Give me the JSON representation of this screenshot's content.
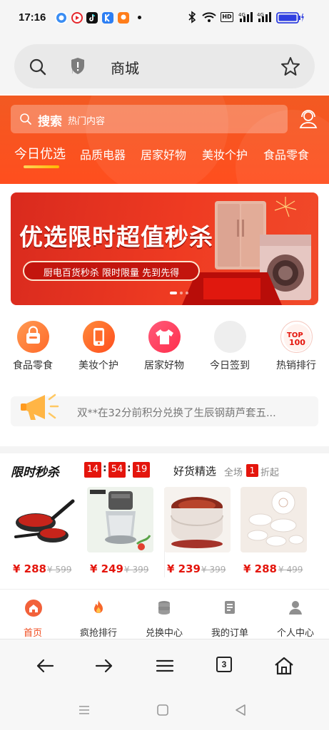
{
  "status_bar": {
    "time": "17:16",
    "battery_label": "HD",
    "signal_a": "4G",
    "signal_b": "4G"
  },
  "browser": {
    "address_title": "商城",
    "tab_count": "3"
  },
  "header": {
    "search_label": "搜索",
    "search_placeholder": "热门内容",
    "tabs": [
      {
        "label": "今日优选"
      },
      {
        "label": "品质电器"
      },
      {
        "label": "居家好物"
      },
      {
        "label": "美妆个护"
      },
      {
        "label": "食品零食"
      }
    ]
  },
  "banner": {
    "title": "优选限时超值秒杀",
    "subtitle": "厨电百货秒杀 限时限量 先到先得"
  },
  "categories": [
    {
      "label": "食品零食",
      "icon": "bag-icon",
      "color": "#ff7a3c"
    },
    {
      "label": "美妆个护",
      "icon": "phone-icon",
      "color": "#ff5a2e"
    },
    {
      "label": "居家好物",
      "icon": "shirt-icon",
      "color": "#ff3f5e"
    },
    {
      "label": "今日签到",
      "icon": "placeholder-icon",
      "color": "#eeeeee"
    },
    {
      "label": "热销排行",
      "icon": "top100-icon",
      "color": "#ffffff"
    }
  ],
  "notice": {
    "text": "双**在32分前积分兑换了生辰钢葫芦套五..."
  },
  "flash_sale": {
    "title": "限时秒杀",
    "hours": "14",
    "minutes": "54",
    "seconds": "19"
  },
  "good_picks": {
    "title": "好货精选",
    "sub_prefix": "全场",
    "badge": "1",
    "sub_suffix": "折起"
  },
  "products": [
    {
      "name": "炒锅套装",
      "price": "¥ 288",
      "original": "¥ 599"
    },
    {
      "name": "绞肉机",
      "price": "¥ 249",
      "original": "¥ 399"
    },
    {
      "name": "足浴盆",
      "price": "¥ 239",
      "original": "¥ 399"
    },
    {
      "name": "陶瓷餐具",
      "price": "¥ 288",
      "original": "¥ 499"
    }
  ],
  "bottom_nav": [
    {
      "label": "首页",
      "icon": "home-icon"
    },
    {
      "label": "疯抢排行",
      "icon": "fire-icon"
    },
    {
      "label": "兑换中心",
      "icon": "coins-icon"
    },
    {
      "label": "我的订单",
      "icon": "order-icon"
    },
    {
      "label": "个人中心",
      "icon": "user-icon"
    }
  ],
  "colors": {
    "brand": "#f24d1e",
    "price_red": "#e4150c"
  }
}
